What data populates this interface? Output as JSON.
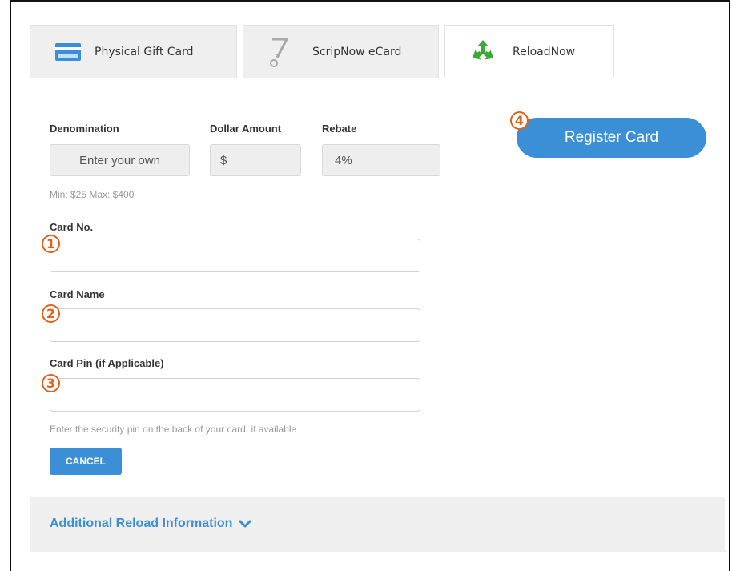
{
  "tabs": [
    {
      "label": "Physical Gift Card",
      "icon": "credit-card-icon"
    },
    {
      "label": "ScripNow eCard",
      "icon": "scripnow-icon"
    },
    {
      "label": "ReloadNow",
      "icon": "recycle-icon"
    }
  ],
  "form": {
    "denomination_label": "Denomination",
    "denomination_value": "Enter your own",
    "dollar_label": "Dollar Amount",
    "dollar_value": "$",
    "rebate_label": "Rebate",
    "rebate_value": "4%",
    "minmax": "Min: $25 Max: $400",
    "card_no_label": "Card No.",
    "card_no_value": "",
    "card_name_label": "Card Name",
    "card_name_value": "",
    "card_pin_label": "Card Pin (if Applicable)",
    "card_pin_value": "",
    "pin_help": "Enter the security pin on the back of your card, if available",
    "cancel_label": "CANCEL",
    "register_label": "Register Card"
  },
  "badges": [
    "1",
    "2",
    "3",
    "4"
  ],
  "footer": {
    "link_label": "Additional Reload Information"
  },
  "colors": {
    "accent": "#3b8fd6",
    "badge": "#e2621b",
    "recycle": "#3aa935"
  }
}
